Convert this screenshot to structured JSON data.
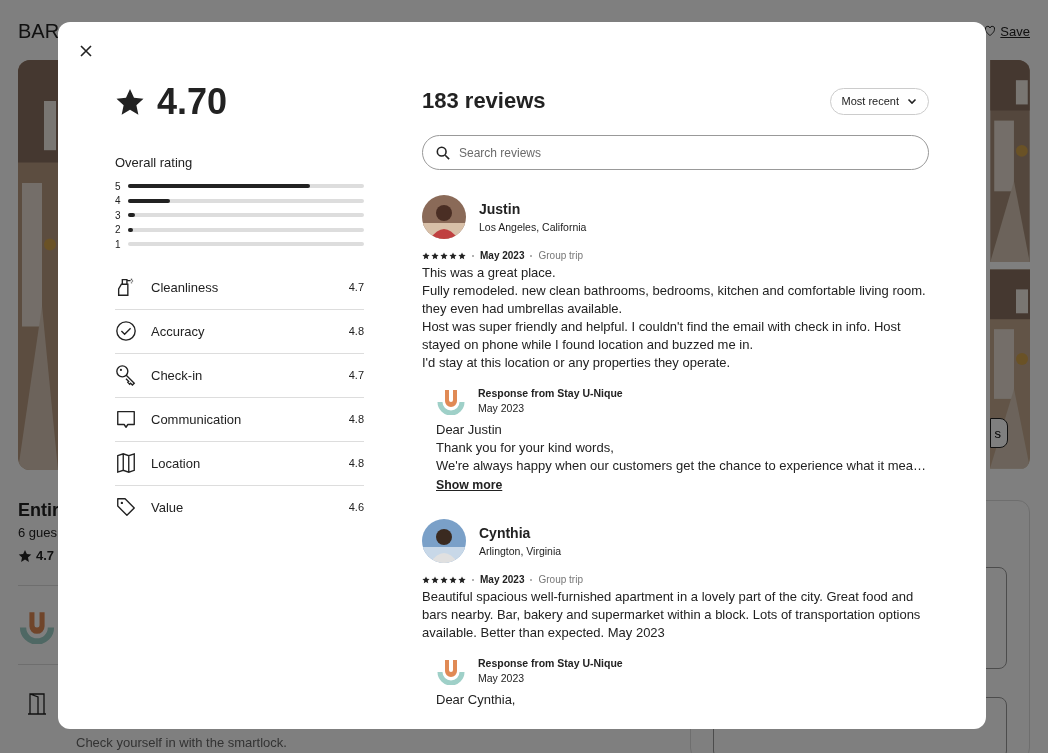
{
  "page": {
    "title": "BAR",
    "save": "Save",
    "photos_button": "s",
    "listing_title": "Entir",
    "guests": "6 gues",
    "rating": "4.7",
    "checkin_note": "Check yourself in with the smartlock."
  },
  "reviews_modal": {
    "overall_score": "4.70",
    "rating_label": "Overall rating",
    "distribution": [
      {
        "label": "5",
        "level": 0.77
      },
      {
        "label": "4",
        "level": 0.18
      },
      {
        "label": "3",
        "level": 0.03
      },
      {
        "label": "2",
        "level": 0.02
      },
      {
        "label": "1",
        "level": 0
      }
    ],
    "categories": [
      {
        "kind": "spray",
        "name": "Cleanliness",
        "score": "4.7"
      },
      {
        "kind": "check",
        "name": "Accuracy",
        "score": "4.8"
      },
      {
        "kind": "key",
        "name": "Check-in",
        "score": "4.7"
      },
      {
        "kind": "chat",
        "name": "Communication",
        "score": "4.8"
      },
      {
        "kind": "map",
        "name": "Location",
        "score": "4.8"
      },
      {
        "kind": "tag",
        "name": "Value",
        "score": "4.6"
      }
    ],
    "reviews_count": "183 reviews",
    "sort": "Most recent",
    "search_placeholder": "Search reviews",
    "reviews": [
      {
        "name": "Justin",
        "location": "Los Angeles, California",
        "stars": 5,
        "date": "May 2023",
        "trip": "Group trip",
        "paragraphs": [
          "This was a great place.",
          "Fully remodeled. new clean bathrooms, bedrooms, kitchen and comfortable living room.",
          "they even had umbrellas available.",
          "Host was super friendly and helpful. I couldn't find the email with check in info. Host stayed on phone while I found location and buzzed me in.",
          "I'd stay at this location or any properties they operate."
        ],
        "response": {
          "title": "Response from Stay U-Nique",
          "date": "May 2023",
          "paragraphs": [
            "Dear Justin",
            "Thank you for your kind words,",
            "We're always happy when our customers get the chance to experience what it mea…"
          ],
          "show_more": "Show more"
        }
      },
      {
        "name": "Cynthia",
        "location": "Arlington, Virginia",
        "stars": 5,
        "date": "May 2023",
        "trip": "Group trip",
        "paragraphs": [
          "Beautiful spacious well-furnished apartment in a lovely part of the city. Great food and bars nearby. Bar, bakery and supermarket within a block. Lots of transportation options available. Better than expected. May 2023"
        ],
        "response": {
          "title": "Response from Stay U-Nique",
          "date": "May 2023",
          "paragraphs": [
            "Dear Cynthia,"
          ]
        }
      }
    ]
  }
}
